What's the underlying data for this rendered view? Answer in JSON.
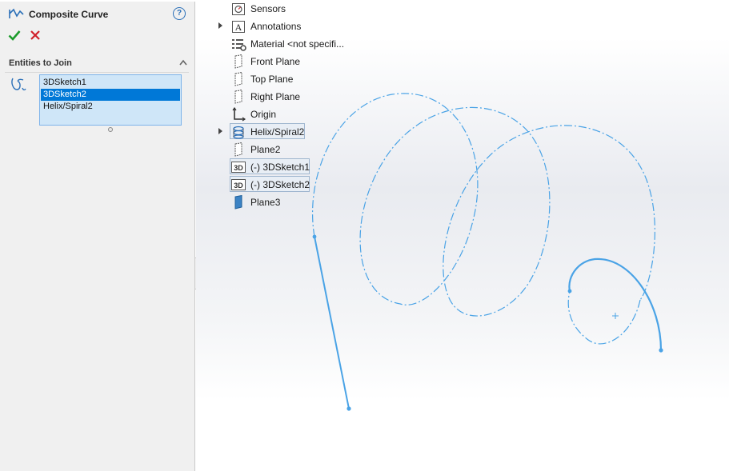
{
  "property_manager": {
    "title": "Composite Curve",
    "help_symbol": "?",
    "group_title": "Entities to Join",
    "entities": [
      "3DSketch1",
      "3DSketch2",
      "Helix/Spiral2"
    ],
    "selected_entity": "3DSketch2"
  },
  "feature_tree": [
    {
      "label": "Sensors",
      "icon": "sensors-icon",
      "expandable": false
    },
    {
      "label": "Annotations",
      "icon": "annotations-icon",
      "expandable": true,
      "glyph": "A"
    },
    {
      "label": "Material <not specifi...",
      "icon": "material-icon",
      "expandable": false
    },
    {
      "label": "Front Plane",
      "icon": "plane-icon",
      "expandable": false
    },
    {
      "label": "Top Plane",
      "icon": "plane-icon",
      "expandable": false
    },
    {
      "label": "Right Plane",
      "icon": "plane-icon",
      "expandable": false
    },
    {
      "label": "Origin",
      "icon": "origin-icon",
      "expandable": false
    },
    {
      "label": "Helix/Spiral2",
      "icon": "helix-icon",
      "expandable": true,
      "highlighted": true
    },
    {
      "label": "Plane2",
      "icon": "plane-icon",
      "expandable": false
    },
    {
      "label": "(-) 3DSketch1",
      "icon": "sketch3d-icon",
      "expandable": false,
      "highlighted": true,
      "glyph": "3D"
    },
    {
      "label": "(-) 3DSketch2",
      "icon": "sketch3d-icon",
      "expandable": false,
      "highlighted": true,
      "glyph": "3D"
    },
    {
      "label": "Plane3",
      "icon": "plane-solid-icon",
      "expandable": false
    }
  ],
  "colors": {
    "accent": "#0078d7",
    "curve": "#4aa3e6",
    "ok": "#1a9b2a",
    "cancel": "#d0202a"
  }
}
